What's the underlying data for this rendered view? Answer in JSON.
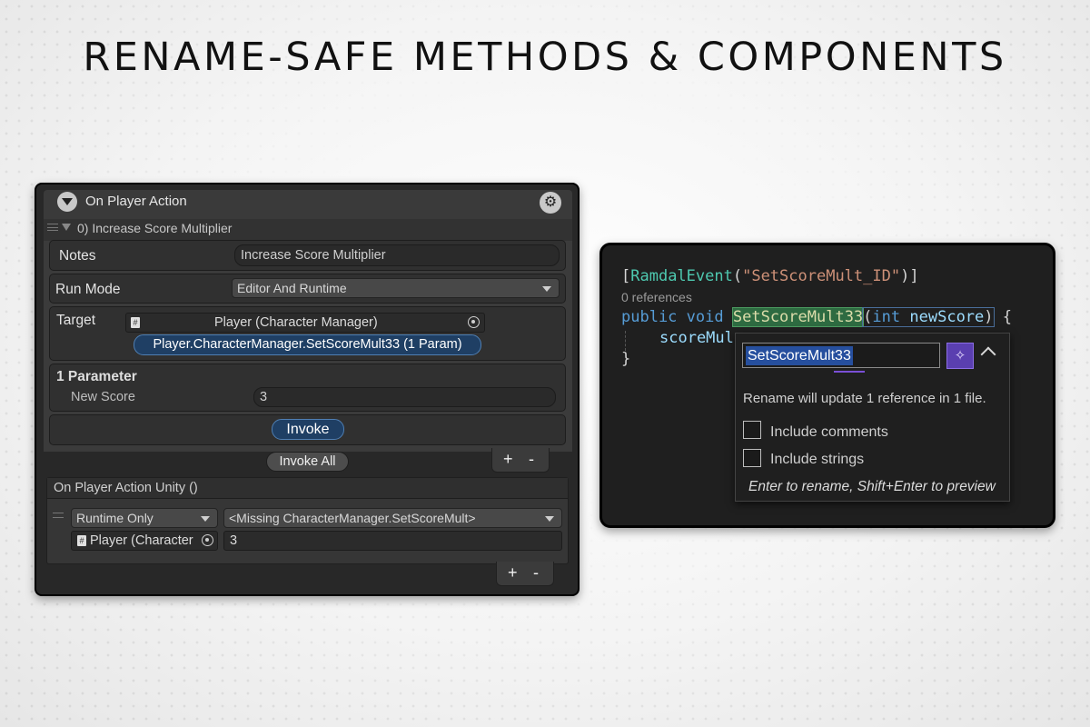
{
  "headline": "RENAME-SAFE METHODS & COMPONENTS",
  "unity": {
    "header_title": "On Player Action",
    "entry_label": "0) Increase Score Multiplier",
    "notes": {
      "label": "Notes",
      "value": "Increase Score Multiplier"
    },
    "run_mode": {
      "label": "Run Mode",
      "value": "Editor And Runtime"
    },
    "target": {
      "label": "Target",
      "object": "Player (Character Manager)",
      "method": "Player.CharacterManager.SetScoreMult33 (1 Param)"
    },
    "params": {
      "heading": "1 Parameter",
      "name": "New Score",
      "value": "3"
    },
    "invoke_label": "Invoke",
    "invoke_all_label": "Invoke All",
    "plus": "+",
    "minus": "-",
    "unity_event": {
      "title": "On Player Action Unity ()",
      "runtime": "Runtime Only",
      "function": "<Missing CharacterManager.SetScoreMult>",
      "object": "Player (Character",
      "arg": "3"
    }
  },
  "code": {
    "attr_open": "[",
    "attr_name": "RamdalEvent",
    "attr_paren_open": "(",
    "attr_string": "\"SetScoreMult_ID\"",
    "attr_close": ")]",
    "refs": "0 references",
    "kw_public": "public",
    "kw_void": "void",
    "method": "SetScoreMult33",
    "paren_open": "(",
    "kw_int": "int",
    "param": "newScore",
    "paren_close": ")",
    "brace_open": "{",
    "body_line": "scoreMul",
    "brace_close": "}",
    "colors": {
      "keyword": "#569cd6",
      "type_name": "#4ec9b0",
      "string": "#ce9178",
      "param": "#9cdcfe",
      "highlight": "#2f6a3f"
    }
  },
  "rename": {
    "input_value": "SetScoreMult33",
    "info": "Rename will update 1 reference in 1 file.",
    "include_comments": "Include comments",
    "include_strings": "Include strings",
    "hint": "Enter to rename, Shift+Enter to preview"
  },
  "icons": {
    "foldout": "triangle-down-icon",
    "gear": "gear-icon",
    "script": "script-icon",
    "target": "object-picker-icon",
    "sparkle": "sparkle-icon",
    "collapse": "chevron-up-icon"
  }
}
